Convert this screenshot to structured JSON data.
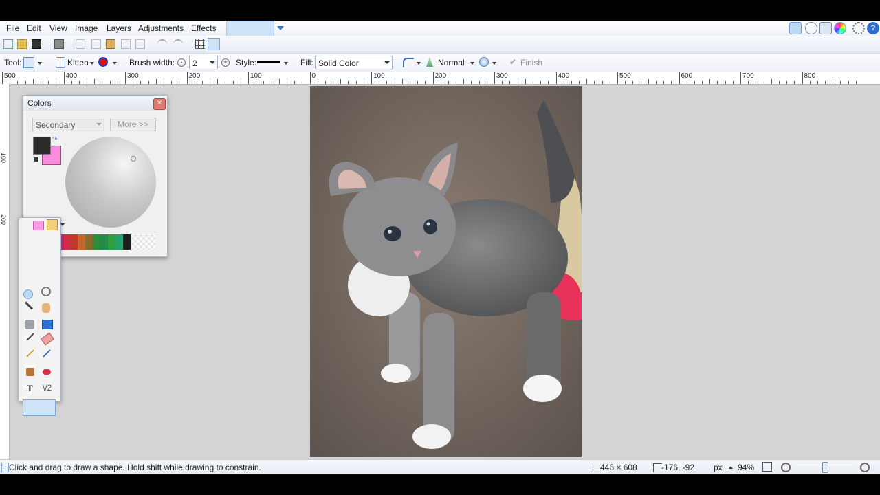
{
  "menubar": {
    "items": [
      "File",
      "Edit",
      "View",
      "Image",
      "Layers",
      "Adjustments",
      "Effects"
    ]
  },
  "toolbar": {
    "tool_label": "Tool:",
    "preset": "Kitten",
    "brush_width_label": "Brush width:",
    "brush_width_value": "2",
    "style_label": "Style:",
    "fill_label": "Fill:",
    "fill_value": "Solid Color",
    "blend_mode": "Normal",
    "finish_label": "Finish"
  },
  "ruler": {
    "labels": [
      "500",
      "400",
      "300",
      "200",
      "100",
      "0",
      "100",
      "200",
      "300",
      "400",
      "500",
      "600",
      "700",
      "800"
    ],
    "left_labels": [
      "100",
      "200"
    ]
  },
  "colors_window": {
    "title": "Colors",
    "mode": "Secondary",
    "more_button": "More >>",
    "primary_color": "#2a2a2a",
    "secondary_color": "#ff8ce0",
    "palette": [
      "#1e1e2e",
      "#2b3cff",
      "#7c2bd0",
      "#c22bb0",
      "#d42b4a",
      "#c0392b",
      "#c6682b",
      "#8a6b2b",
      "#2e8b3a",
      "#238c4a",
      "#2f9f3f",
      "#25a06a",
      "#1e1e1e"
    ]
  },
  "statusbar": {
    "hint": "Click and drag to draw a shape. Hold shift while drawing to constrain.",
    "image_size": "446 × 608",
    "cursor_position": "-176, -92",
    "units": "px",
    "zoom": "94%"
  },
  "accent_color": "#cde3f8"
}
